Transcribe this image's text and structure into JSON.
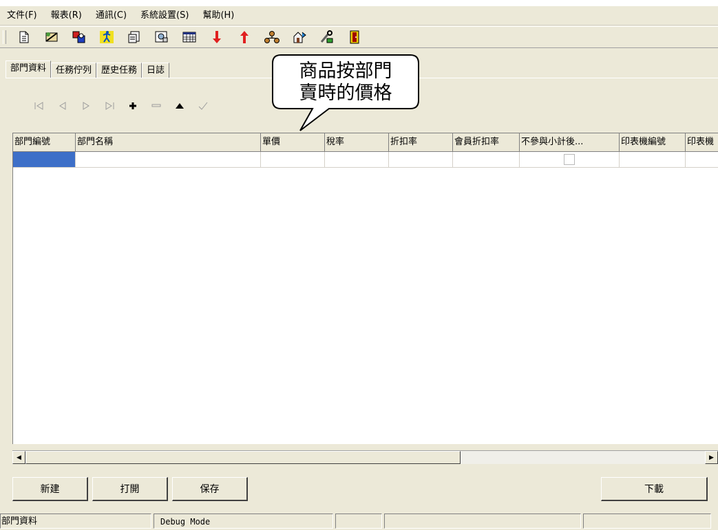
{
  "menu": [
    "文件(F)",
    "報表(R)",
    "通訊(C)",
    "系統設置(S)",
    "幫助(H)"
  ],
  "toolbar_icons": [
    "new-doc-icon",
    "tools-icon",
    "users-icon",
    "run-icon",
    "copy-icon",
    "export-icon",
    "calendar-icon",
    "download-arrow-icon",
    "upload-arrow-icon",
    "network-icon",
    "transfer-icon",
    "settings-icon",
    "exit-icon"
  ],
  "tabs": [
    "部門資料",
    "任務佇列",
    "歷史任務",
    "日誌"
  ],
  "nav_icons": [
    "first-record-icon",
    "prev-record-icon",
    "next-record-icon",
    "last-record-icon",
    "add-record-icon",
    "delete-record-icon",
    "edit-record-icon",
    "post-record-icon"
  ],
  "table": {
    "columns": [
      "部門編號",
      "部門名稱",
      "單價",
      "稅率",
      "折扣率",
      "會員折扣率",
      "不參與小計後...",
      "印表機編號",
      "印表機"
    ],
    "rows": [
      {
        "values": [
          "",
          "",
          "",
          "",
          "",
          "",
          "",
          "",
          ""
        ],
        "checkbox_checked": false
      }
    ]
  },
  "callout": {
    "line1": "商品按部門",
    "line2": "賣時的價格"
  },
  "buttons": {
    "new": "新建",
    "open": "打開",
    "save": "保存",
    "download": "下載"
  },
  "status": {
    "panel1": "部門資料",
    "panel2": "Debug Mode",
    "panel3": "",
    "panel4": "",
    "panel5": "",
    "panel6": ""
  },
  "colors": {
    "background": "#ece9d8",
    "selection": "#3d6fc8"
  }
}
